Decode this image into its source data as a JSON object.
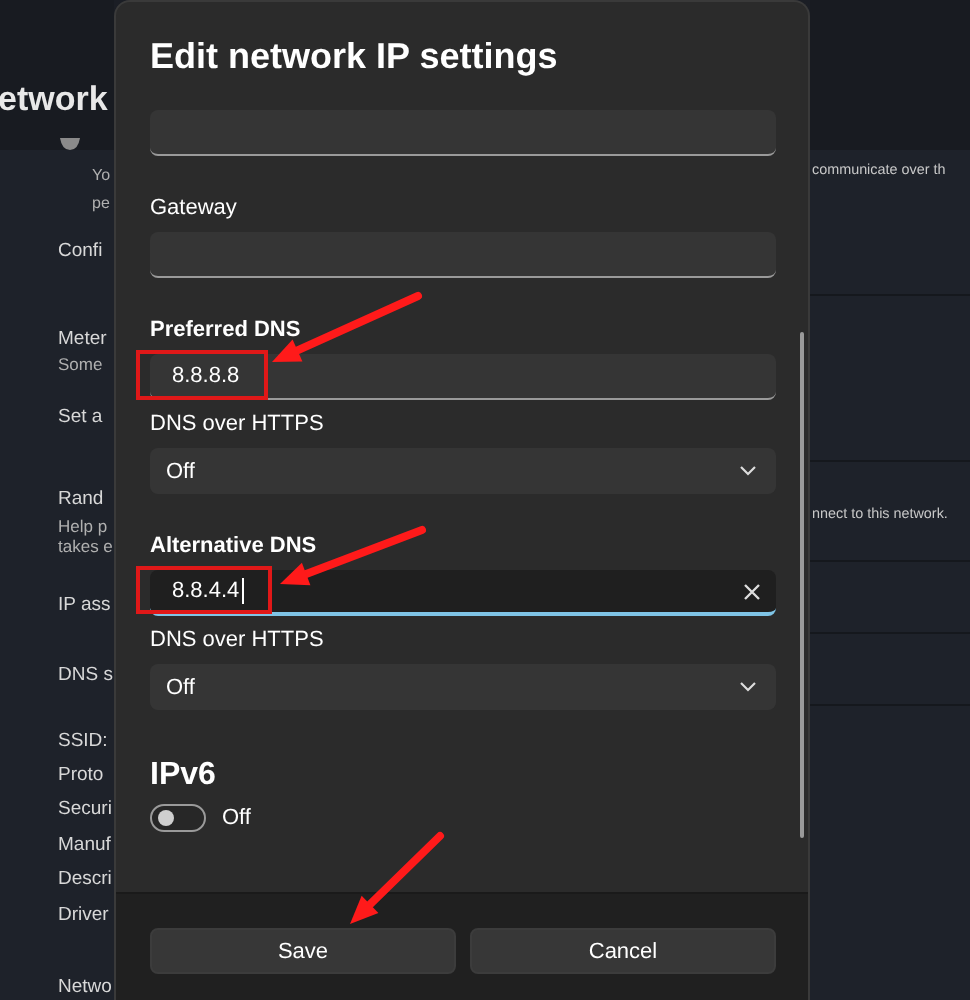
{
  "background": {
    "page_title": "etwork",
    "left_texts": [
      {
        "kind": "note",
        "text": "Yo"
      },
      {
        "kind": "note",
        "text": "pe"
      },
      {
        "kind": "row",
        "text": "Confi"
      },
      {
        "kind": "row",
        "text": "Meter"
      },
      {
        "kind": "sub",
        "text": "Some"
      },
      {
        "kind": "row",
        "text": "Set a"
      },
      {
        "kind": "row",
        "text": "Rand"
      },
      {
        "kind": "sub",
        "text": "Help p"
      },
      {
        "kind": "sub",
        "text": "takes e"
      },
      {
        "kind": "row",
        "text": "IP ass"
      },
      {
        "kind": "row",
        "text": "DNS s"
      },
      {
        "kind": "row",
        "text": "SSID:"
      },
      {
        "kind": "row",
        "text": "Proto"
      },
      {
        "kind": "row",
        "text": "Securi"
      },
      {
        "kind": "row",
        "text": "Manuf"
      },
      {
        "kind": "row",
        "text": "Descri"
      },
      {
        "kind": "row",
        "text": "Driver"
      },
      {
        "kind": "row",
        "text": "Netwo"
      }
    ],
    "right_texts": [
      "communicate over th",
      "nnect to this network."
    ]
  },
  "dialog": {
    "title": "Edit network IP settings",
    "fields": [
      {
        "kind": "text",
        "focused": false
      },
      {
        "kind": "text",
        "label": "Gateway",
        "label_bold": false,
        "focused": false
      },
      {
        "kind": "text",
        "label": "Preferred DNS",
        "label_bold": true,
        "value": "8.8.8.8",
        "focused": false
      },
      {
        "kind": "dropdown",
        "label": "DNS over HTTPS",
        "value": "Off"
      },
      {
        "kind": "text",
        "label": "Alternative DNS",
        "label_bold": true,
        "value": "8.8.4.4",
        "focused": true
      },
      {
        "kind": "dropdown",
        "label": "DNS over HTTPS",
        "value": "Off"
      }
    ],
    "ipv6": {
      "heading": "IPv6",
      "on": false,
      "state_label": "Off"
    },
    "buttons": [
      "Save",
      "Cancel"
    ]
  }
}
